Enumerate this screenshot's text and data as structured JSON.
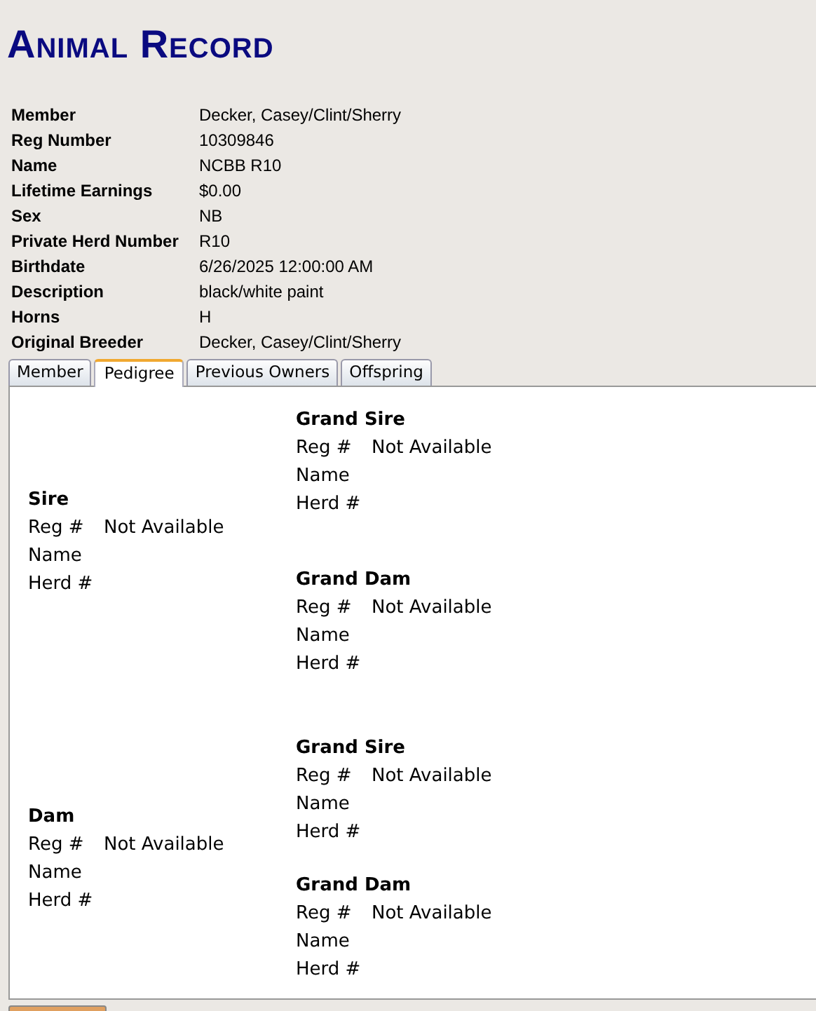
{
  "title": "Animal Record",
  "details": [
    {
      "label": "Member",
      "value": "Decker, Casey/Clint/Sherry"
    },
    {
      "label": "Reg Number",
      "value": "10309846"
    },
    {
      "label": "Name",
      "value": "NCBB R10"
    },
    {
      "label": "Lifetime Earnings",
      "value": "$0.00"
    },
    {
      "label": "Sex",
      "value": "NB"
    },
    {
      "label": "Private Herd Number",
      "value": "R10"
    },
    {
      "label": "Birthdate",
      "value": "6/26/2025 12:00:00 AM"
    },
    {
      "label": "Description",
      "value": "black/white paint"
    },
    {
      "label": "Horns",
      "value": "H"
    },
    {
      "label": "Original Breeder",
      "value": "Decker, Casey/Clint/Sherry"
    }
  ],
  "tabs": [
    {
      "label": "Member",
      "selected": false
    },
    {
      "label": "Pedigree",
      "selected": true
    },
    {
      "label": "Previous Owners",
      "selected": false
    },
    {
      "label": "Offspring",
      "selected": false
    }
  ],
  "pedigree": [
    {
      "title": "Sire",
      "reg_label": "Reg #",
      "reg_value": "Not Available",
      "name_label": "Name",
      "herd_label": "Herd #",
      "grandparents": [
        {
          "title": "Grand Sire",
          "reg_label": "Reg #",
          "reg_value": "Not Available",
          "name_label": "Name",
          "herd_label": "Herd #"
        },
        {
          "title": "Grand Dam",
          "reg_label": "Reg #",
          "reg_value": "Not Available",
          "name_label": "Name",
          "herd_label": "Herd #"
        }
      ]
    },
    {
      "title": "Dam",
      "reg_label": "Reg #",
      "reg_value": "Not Available",
      "name_label": "Name",
      "herd_label": "Herd #",
      "grandparents": [
        {
          "title": "Grand Sire",
          "reg_label": "Reg #",
          "reg_value": "Not Available",
          "name_label": "Name",
          "herd_label": "Herd #"
        },
        {
          "title": "Grand Dam",
          "reg_label": "Reg #",
          "reg_value": "Not Available",
          "name_label": "Name",
          "herd_label": "Herd #"
        }
      ]
    }
  ]
}
